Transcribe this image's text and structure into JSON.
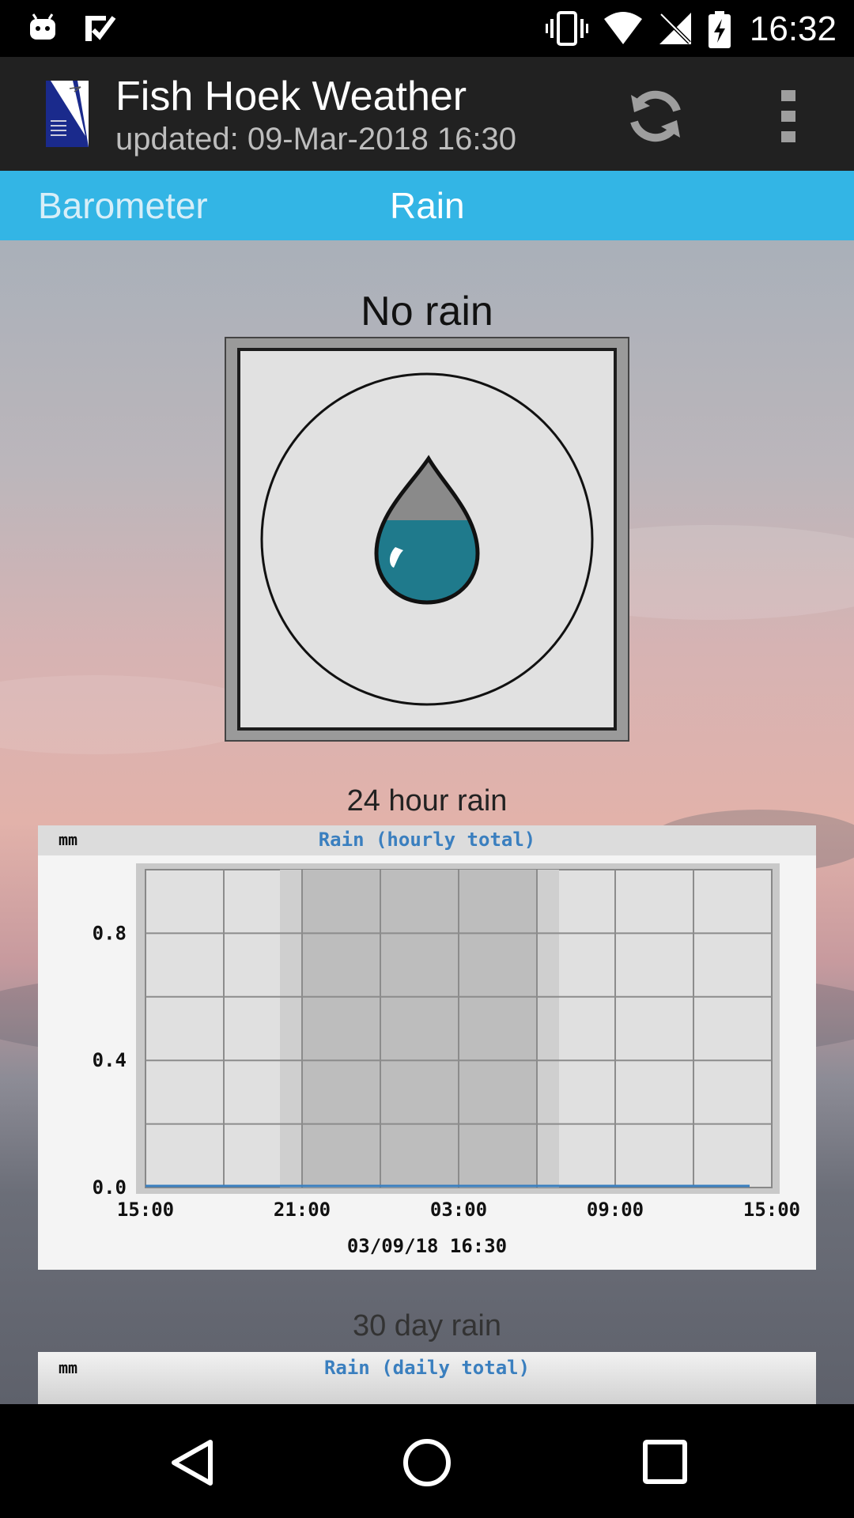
{
  "status_bar": {
    "time": "16:32"
  },
  "app_bar": {
    "title": "Fish Hoek Weather",
    "subtitle": "updated: 09-Mar-2018 16:30"
  },
  "tabs": [
    {
      "label": "Barometer",
      "selected": false
    },
    {
      "label": "Rain",
      "selected": true
    }
  ],
  "rain_now": {
    "status": "No rain"
  },
  "hourly_section": {
    "label": "24 hour rain"
  },
  "daily_section": {
    "label": "30 day rain"
  },
  "colors": {
    "accent": "#33b5e5",
    "app_bar": "#212121",
    "chart_title": "#3a7fbf",
    "drop_water": "#1f7a8c"
  },
  "icons": [
    "android-icon",
    "check-icon",
    "vibrate-icon",
    "wifi-icon",
    "no-signal-icon",
    "battery-charging-icon",
    "refresh-icon",
    "overflow-menu-icon",
    "water-drop-icon",
    "back-icon",
    "home-icon",
    "recents-icon"
  ],
  "chart_data": [
    {
      "type": "line",
      "title": "Rain (hourly total)",
      "ylabel": "mm",
      "xlabel": "03/09/18 16:30",
      "x_ticks": [
        "15:00",
        "21:00",
        "03:00",
        "09:00",
        "15:00"
      ],
      "y_ticks": [
        "0.0",
        "0.4",
        "0.8"
      ],
      "ylim": [
        0,
        1.0
      ],
      "grid": true,
      "shaded_night": [
        "21:00",
        "06:00"
      ],
      "series": [
        {
          "values": [
            0,
            0,
            0,
            0,
            0,
            0,
            0,
            0,
            0,
            0,
            0,
            0,
            0,
            0,
            0,
            0,
            0,
            0,
            0,
            0,
            0,
            0,
            0,
            0,
            0
          ]
        }
      ]
    },
    {
      "type": "bar",
      "title": "Rain (daily total)",
      "ylabel": "mm"
    }
  ]
}
